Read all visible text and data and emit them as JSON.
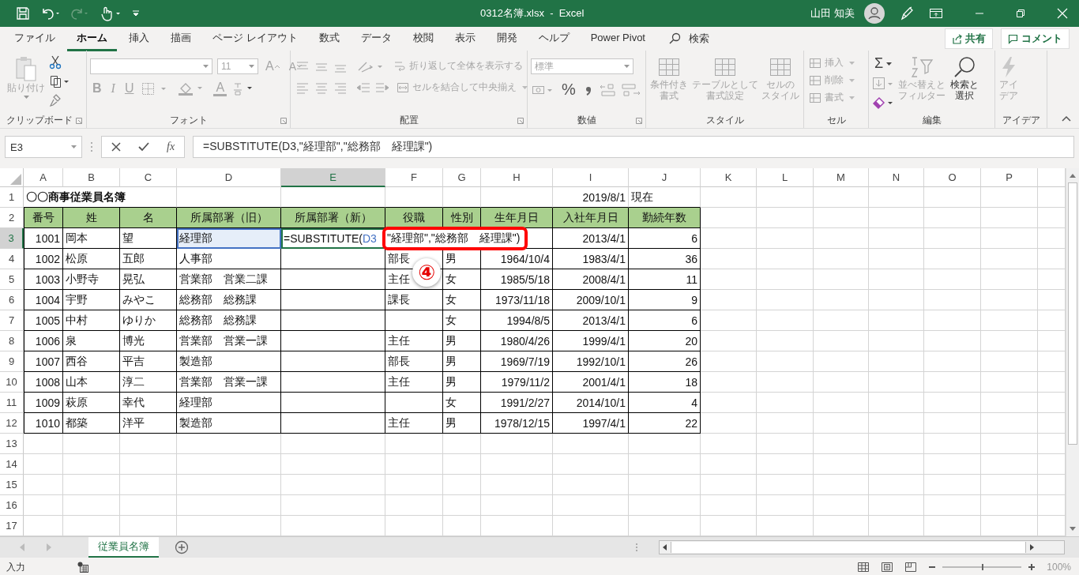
{
  "title_bar": {
    "file_title": "0312名簿.xlsx  -  Excel",
    "user_name": "山田 知美"
  },
  "menu_tabs": [
    {
      "label": "ファイル",
      "selected": false
    },
    {
      "label": "ホーム",
      "selected": true
    },
    {
      "label": "挿入",
      "selected": false
    },
    {
      "label": "描画",
      "selected": false
    },
    {
      "label": "ページ レイアウト",
      "selected": false
    },
    {
      "label": "数式",
      "selected": false
    },
    {
      "label": "データ",
      "selected": false
    },
    {
      "label": "校閲",
      "selected": false
    },
    {
      "label": "表示",
      "selected": false
    },
    {
      "label": "開発",
      "selected": false
    },
    {
      "label": "ヘルプ",
      "selected": false
    },
    {
      "label": "Power Pivot",
      "selected": false
    }
  ],
  "search": {
    "label": "検索"
  },
  "share_button": "共有",
  "comment_button": "コメント",
  "ribbon": {
    "clipboard": {
      "label": "クリップボード",
      "paste": {
        "label": "貼り付け",
        "disabled": true
      }
    },
    "font": {
      "label": "フォント",
      "font_size": "11",
      "grow": "A",
      "shrink": "A",
      "styles": [
        "B",
        "I",
        "U"
      ],
      "font_color": "A"
    },
    "alignment": {
      "label": "配置",
      "wrap": {
        "label": "折り返して全体を表示する",
        "disabled": true
      },
      "merge": {
        "label": "セルを結合して中央揃え",
        "disabled": true
      }
    },
    "number": {
      "label": "数値",
      "format": "標準",
      "percent": "%"
    },
    "styles": {
      "label": "スタイル",
      "buttons": [
        {
          "lines": [
            "条件付き",
            "書式"
          ],
          "disabled": true
        },
        {
          "lines": [
            "テーブルとして",
            "書式設定"
          ],
          "disabled": true
        },
        {
          "lines": [
            "セルの",
            "スタイル"
          ],
          "disabled": true
        }
      ]
    },
    "cells": {
      "label": "セル",
      "buttons": [
        {
          "label": "挿入",
          "disabled": true
        },
        {
          "label": "削除",
          "disabled": true
        },
        {
          "label": "書式",
          "disabled": true
        }
      ]
    },
    "editing": {
      "label": "編集",
      "sum": "Σ",
      "sort": {
        "lines": [
          "並べ替えと",
          "フィルター"
        ],
        "disabled": true
      },
      "find": {
        "lines": [
          "検索と",
          "選択"
        ],
        "disabled": false
      }
    },
    "ideas": {
      "label": "アイデア",
      "button": {
        "lines": [
          "アイ",
          "デア"
        ],
        "disabled": true
      }
    }
  },
  "formula_bar": {
    "name_box": "E3",
    "function_glyph": "fx",
    "formula": "=SUBSTITUTE(D3,\"経理部\",\"総務部　経理課\")"
  },
  "sheet": {
    "columns": [
      {
        "label": "A",
        "selected": false
      },
      {
        "label": "B",
        "selected": false
      },
      {
        "label": "C",
        "selected": false
      },
      {
        "label": "D",
        "selected": false
      },
      {
        "label": "E",
        "selected": true
      },
      {
        "label": "F",
        "selected": false
      },
      {
        "label": "G",
        "selected": false
      },
      {
        "label": "H",
        "selected": false
      },
      {
        "label": "I",
        "selected": false
      },
      {
        "label": "J",
        "selected": false
      },
      {
        "label": "K",
        "selected": false
      },
      {
        "label": "L",
        "selected": false
      },
      {
        "label": "M",
        "selected": false
      },
      {
        "label": "N",
        "selected": false
      },
      {
        "label": "O",
        "selected": false
      },
      {
        "label": "P",
        "selected": false
      }
    ],
    "rows": [
      {
        "number": "1",
        "selected": false,
        "kind": "title",
        "cells": [
          "〇〇商事従業員名簿",
          "",
          "",
          "",
          "",
          "",
          "",
          "",
          "2019/8/1",
          "現在"
        ]
      },
      {
        "number": "2",
        "selected": false,
        "kind": "header",
        "cells": [
          "番号",
          "姓",
          "名",
          "所属部署（旧）",
          "所属部署（新）",
          "役職",
          "性別",
          "生年月日",
          "入社年月日",
          "勤続年数"
        ]
      },
      {
        "number": "3",
        "selected": true,
        "kind": "data",
        "cells": [
          "1001",
          "岡本",
          "望",
          {
            "text": "経理部",
            "referenced": true
          },
          "",
          "",
          "",
          "",
          "2013/4/1",
          "6"
        ]
      },
      {
        "number": "4",
        "selected": false,
        "kind": "data",
        "cells": [
          "1002",
          "松原",
          "五郎",
          "人事部",
          "",
          "部長",
          "男",
          "1964/10/4",
          "1983/4/1",
          "36"
        ]
      },
      {
        "number": "5",
        "selected": false,
        "kind": "data",
        "cells": [
          "1003",
          "小野寺",
          "晃弘",
          "営業部　営業二課",
          "",
          "主任",
          "女",
          "1985/5/18",
          "2008/4/1",
          "11"
        ]
      },
      {
        "number": "6",
        "selected": false,
        "kind": "data",
        "cells": [
          "1004",
          "宇野",
          "みやこ",
          "総務部　総務課",
          "",
          "課長",
          "女",
          "1973/11/18",
          "2009/10/1",
          "9"
        ]
      },
      {
        "number": "7",
        "selected": false,
        "kind": "data",
        "cells": [
          "1005",
          "中村",
          "ゆりか",
          "総務部　総務課",
          "",
          "",
          "女",
          "1994/8/5",
          "2013/4/1",
          "6"
        ]
      },
      {
        "number": "8",
        "selected": false,
        "kind": "data",
        "cells": [
          "1006",
          "泉",
          "博光",
          "営業部　営業一課",
          "",
          "主任",
          "男",
          "1980/4/26",
          "1999/4/1",
          "20"
        ]
      },
      {
        "number": "9",
        "selected": false,
        "kind": "data",
        "cells": [
          "1007",
          "西谷",
          "平吉",
          "製造部",
          "",
          "部長",
          "男",
          "1969/7/19",
          "1992/10/1",
          "26"
        ]
      },
      {
        "number": "10",
        "selected": false,
        "kind": "data",
        "cells": [
          "1008",
          "山本",
          "淳二",
          "営業部　営業一課",
          "",
          "主任",
          "男",
          "1979/11/2",
          "2001/4/1",
          "18"
        ]
      },
      {
        "number": "11",
        "selected": false,
        "kind": "data",
        "cells": [
          "1009",
          "萩原",
          "幸代",
          "経理部",
          "",
          "",
          "女",
          "1991/2/27",
          "2014/10/1",
          "4"
        ]
      },
      {
        "number": "12",
        "selected": false,
        "kind": "data",
        "cells": [
          "1010",
          "都築",
          "洋平",
          "製造部",
          "",
          "主任",
          "男",
          "1978/12/15",
          "1997/4/1",
          "22"
        ]
      },
      {
        "number": "13",
        "selected": false,
        "kind": "empty"
      },
      {
        "number": "14",
        "selected": false,
        "kind": "empty"
      },
      {
        "number": "15",
        "selected": false,
        "kind": "empty"
      },
      {
        "number": "16",
        "selected": false,
        "kind": "empty"
      },
      {
        "number": "17",
        "selected": false,
        "kind": "empty"
      }
    ],
    "edit": {
      "prefix": "=SUBSTITUTE(",
      "reference": "D3",
      "callout": "\"経理部\",\"総務部　経理課\")"
    },
    "step_badge": "④"
  },
  "sheet_tabs": [
    {
      "label": "従業員名簿",
      "selected": true
    }
  ],
  "status_bar": {
    "mode": "入力",
    "zoom": {
      "level": 0.5,
      "reading": "100%"
    }
  }
}
